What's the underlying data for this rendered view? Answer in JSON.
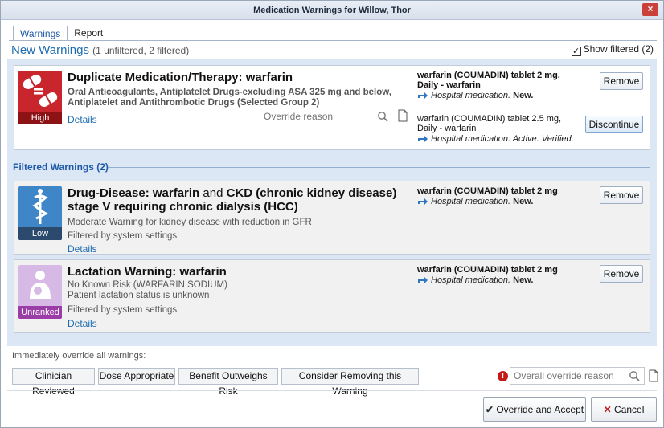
{
  "window": {
    "title": "Medication Warnings for Willow, Thor",
    "close_glyph": "×"
  },
  "tabs": [
    {
      "label": "Warnings"
    },
    {
      "label": "Report"
    }
  ],
  "new_warnings": {
    "heading": "New Warnings",
    "counts": "(1 unfiltered, 2 filtered)",
    "show_filtered_label": "Show filtered (2)",
    "show_filtered_checked": true
  },
  "warnings": [
    {
      "severity": "High",
      "title": "Duplicate Medication/Therapy: warfarin",
      "description": "Oral Anticoagulants, Antiplatelet Drugs-excluding ASA 325 mg and below, Antiplatelet and Antithrombotic Drugs (Selected Group 2)",
      "details_label": "Details",
      "override_placeholder": "Override reason",
      "meds": [
        {
          "name": "warfarin (COUMADIN) tablet 2 mg, Daily - warfarin",
          "source": "Hospital medication.",
          "state": "New.",
          "action": "Remove"
        },
        {
          "name": "warfarin (COUMADIN) tablet 2.5 mg, Daily - warfarin",
          "source": "Hospital medication. Active. Verified.",
          "state": "",
          "action": "Discontinue"
        }
      ]
    }
  ],
  "filtered_heading": "Filtered Warnings (2)",
  "filtered": [
    {
      "severity": "Low",
      "title_part1": "Drug-Disease: warfarin",
      "title_and": "and",
      "title_part2": "CKD (chronic kidney disease) stage V requiring chronic dialysis (HCC)",
      "description": "Moderate Warning for kidney disease with reduction in GFR",
      "filter_note": "Filtered by system settings",
      "details_label": "Details",
      "med": {
        "name": "warfarin (COUMADIN) tablet 2 mg",
        "source": "Hospital medication.",
        "state": "New.",
        "action": "Remove"
      }
    },
    {
      "severity": "Unranked",
      "title": "Lactation Warning: warfarin",
      "description": "No Known Risk (WARFARIN SODIUM)",
      "description2": "Patient lactation status is unknown",
      "filter_note": "Filtered by system settings",
      "details_label": "Details",
      "med": {
        "name": "warfarin (COUMADIN) tablet 2 mg",
        "source": "Hospital medication.",
        "state": "New.",
        "action": "Remove"
      }
    }
  ],
  "bulk": {
    "label": "Immediately override all warnings:",
    "buttons": [
      "Clinician Reviewed",
      "Dose Appropriate",
      "Benefit Outweighs Risk",
      "Consider Removing this Warning"
    ],
    "overall_placeholder": "Overall override reason"
  },
  "footer": {
    "accept_pre": "",
    "accept_key": "O",
    "accept_post": "verride and Accept",
    "cancel_pre": "",
    "cancel_key": "C",
    "cancel_post": "ancel"
  },
  "colors": {
    "high": "#c8262c",
    "low": "#3f86c9",
    "unranked": "#9b3da6",
    "accent": "#1f6cb0"
  }
}
